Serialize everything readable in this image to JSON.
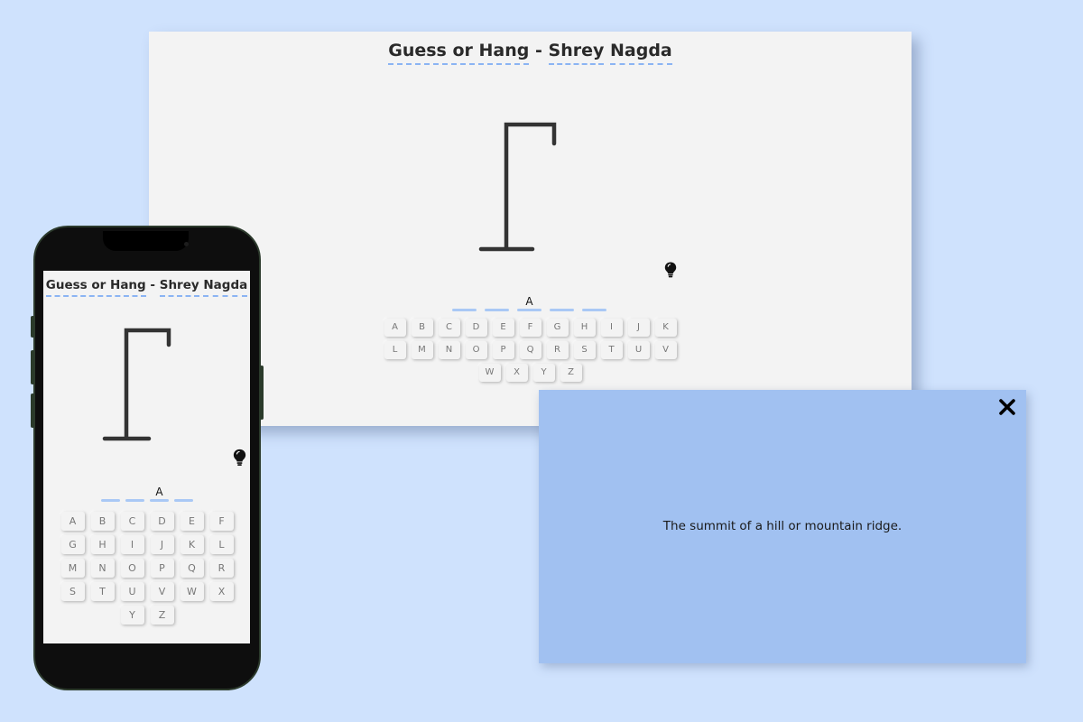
{
  "desktop": {
    "title_part1": "Guess or Hang",
    "title_sep": "-",
    "title_part2": "Shrey",
    "title_part3": "Nagda",
    "revealed_letter": "A",
    "keyboard_rows": [
      [
        "A",
        "B",
        "C",
        "D",
        "E",
        "F",
        "G",
        "H",
        "I",
        "J",
        "K"
      ],
      [
        "L",
        "M",
        "N",
        "O",
        "P",
        "Q",
        "R",
        "S",
        "T",
        "U",
        "V"
      ],
      [
        "W",
        "X",
        "Y",
        "Z"
      ]
    ]
  },
  "phone": {
    "title_part1": "Guess or Hang",
    "title_sep": "-",
    "title_part2": "Shrey",
    "title_part3": "Nagda",
    "revealed_letter": "A",
    "keyboard_rows": [
      [
        "A",
        "B",
        "C",
        "D",
        "E",
        "F"
      ],
      [
        "G",
        "H",
        "I",
        "J",
        "K",
        "L"
      ],
      [
        "M",
        "N",
        "O",
        "P",
        "Q",
        "R"
      ],
      [
        "S",
        "T",
        "U",
        "V",
        "W",
        "X"
      ],
      [
        "Y",
        "Z"
      ]
    ]
  },
  "word": {
    "slots": [
      "",
      "",
      "A",
      "",
      ""
    ]
  },
  "modal": {
    "hint_text": "The summit of a hill or mountain ridge."
  },
  "icons": {
    "hint": "lightbulb-icon",
    "close": "close-icon"
  },
  "colors": {
    "background": "#cfe2fd",
    "modal": "#a1c1f1",
    "underline": "#8bb4f3",
    "slot_dash": "#a9c8f5"
  }
}
